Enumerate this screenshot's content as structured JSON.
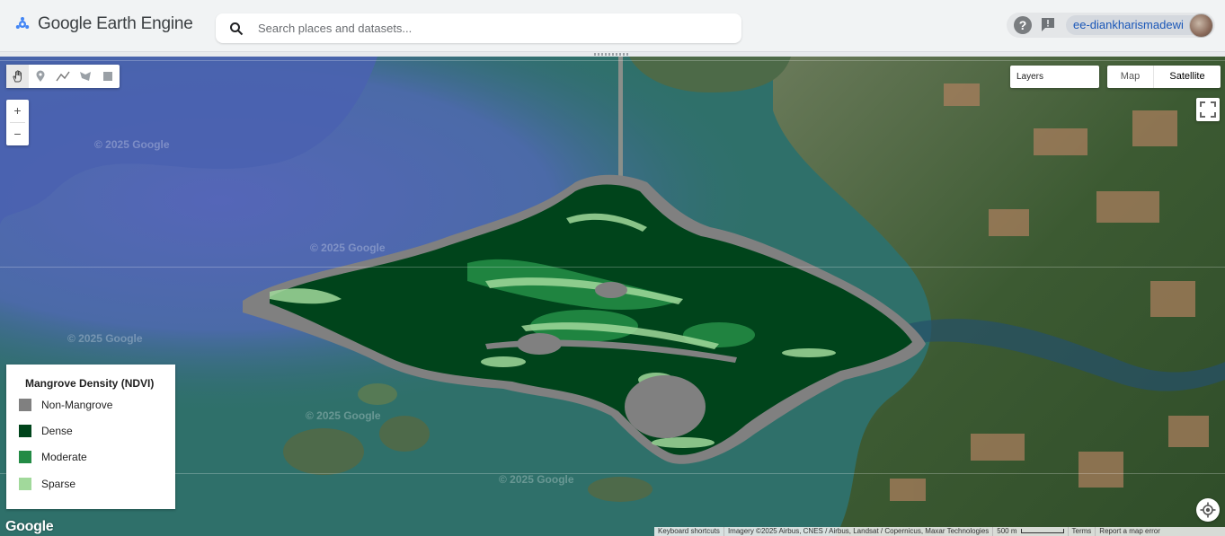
{
  "header": {
    "app_title": "Google Earth Engine",
    "search_placeholder": "Search places and datasets...",
    "username": "ee-diankharismadewi"
  },
  "map_controls": {
    "layers_label": "Layers",
    "maptype_map": "Map",
    "maptype_satellite": "Satellite",
    "zoom_in": "+",
    "zoom_out": "−",
    "tools": [
      "hand-icon",
      "marker-icon",
      "polyline-icon",
      "polygon-icon",
      "rectangle-icon"
    ]
  },
  "legend": {
    "title": "Mangrove Density (NDVI)",
    "items": [
      {
        "label": "Non-Mangrove",
        "color": "#808080"
      },
      {
        "label": "Dense",
        "color": "#00441b"
      },
      {
        "label": "Moderate",
        "color": "#238b45"
      },
      {
        "label": "Sparse",
        "color": "#a1d99b"
      }
    ]
  },
  "watermark": "© 2025 Google",
  "google_logo": "Google",
  "attribution": {
    "shortcuts": "Keyboard shortcuts",
    "imagery": "Imagery ©2025 Airbus, CNES / Airbus, Landsat / Copernicus, Maxar Technologies",
    "scale": "500 m",
    "terms": "Terms",
    "report": "Report a map error"
  },
  "colors": {
    "water_deep": "#5566b0",
    "water_teal": "#2e6f6a",
    "land": "#3a5a2e",
    "non_mangrove": "#808080",
    "dense": "#00441b",
    "moderate": "#238b45",
    "sparse": "#a1d99b"
  }
}
